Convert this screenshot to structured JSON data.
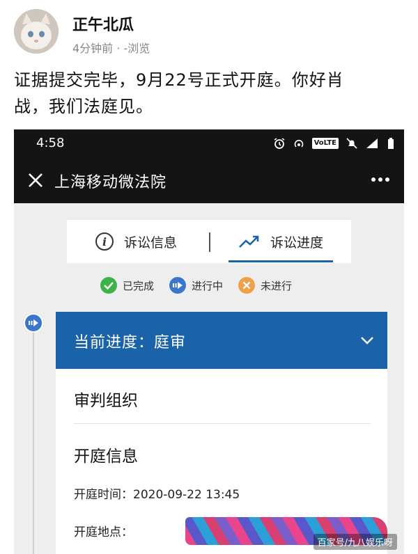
{
  "post": {
    "author": "正午北瓜",
    "meta": "4分钟前 · -浏览",
    "text_line1": "证据提交完毕，9月22号正式开庭。你好肖",
    "text_line2": "战，我们法庭见。"
  },
  "phone": {
    "status_time": "4:58",
    "volte_label": "VoLTE",
    "app_title": "上海移动微法院",
    "tabs": [
      {
        "label": "诉讼信息",
        "icon": "info-icon"
      },
      {
        "label": "诉讼进度",
        "icon": "trend-icon"
      }
    ],
    "legend": [
      {
        "label": "已完成",
        "color": "#3cb34a"
      },
      {
        "label": "进行中",
        "color": "#3b76c9"
      },
      {
        "label": "未进行",
        "color": "#f0a04a"
      }
    ],
    "card": {
      "title": "当前进度：庭审",
      "section1": "审判组织",
      "section2": "开庭信息",
      "time_label": "开庭时间：",
      "time_value": "2020-09-22 13:45",
      "place_label": "开庭地点："
    },
    "accent_color": "#1a63a8"
  },
  "watermark": "百家号/九八娱乐呀"
}
